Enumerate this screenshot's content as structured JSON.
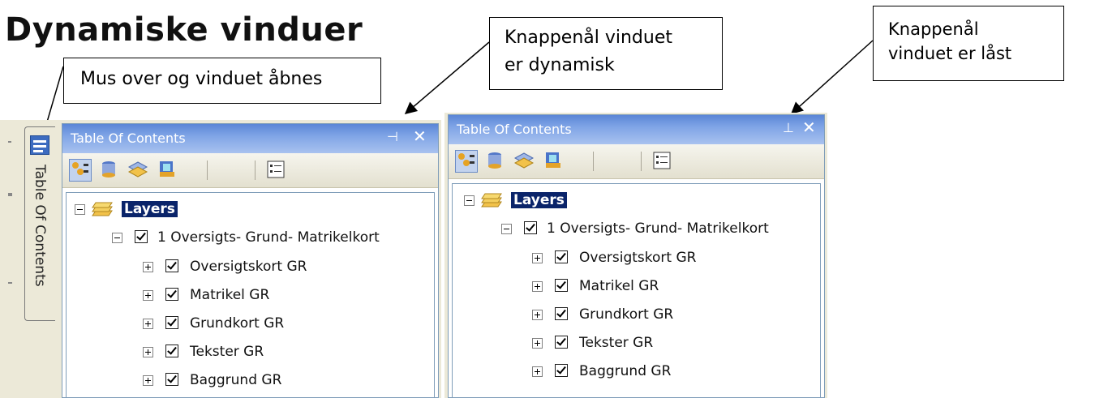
{
  "heading": "Dynamiske vinduer",
  "callouts": {
    "mouse_over": "Mus over og vinduet åbnes",
    "pin_dynamic_line1": "Knappenål vinduet",
    "pin_dynamic_line2": "er dynamisk",
    "pin_locked_line1": "Knappenål",
    "pin_locked_line2": "vinduet er låst"
  },
  "side_tab_label": "Table Of Contents",
  "panels": [
    {
      "title": "Table Of Contents",
      "pin_icon": "pin-unpinned-icon",
      "tree": {
        "root": "Layers",
        "group": "1 Oversigts- Grund- Matrikelkort",
        "layers": [
          "Oversigtskort GR",
          "Matrikel GR",
          "Grundkort GR",
          "Tekster GR",
          "Baggrund GR"
        ]
      }
    },
    {
      "title": "Table Of Contents",
      "pin_icon": "pin-pinned-icon",
      "tree": {
        "root": "Layers",
        "group": "1 Oversigts- Grund- Matrikelkort",
        "layers": [
          "Oversigtskort GR",
          "Matrikel GR",
          "Grundkort GR",
          "Tekster GR",
          "Baggrund GR"
        ]
      }
    }
  ],
  "toolbar_buttons": [
    "list-by-drawing-order-icon",
    "list-by-source-icon",
    "list-by-visibility-icon",
    "list-by-selection-icon",
    "options-icon"
  ],
  "colors": {
    "titlebar": "#5b86d6",
    "selected_root": "#0a246a",
    "panel_bg": "#ece9d8"
  }
}
